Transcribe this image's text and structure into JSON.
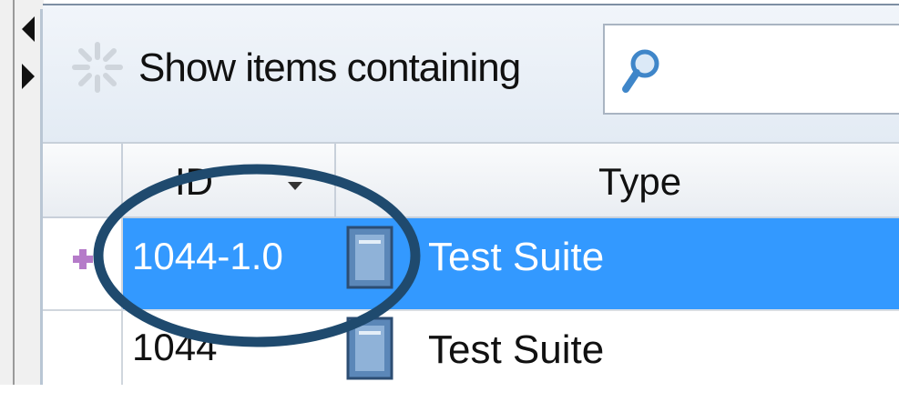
{
  "filter": {
    "label": "Show items containing",
    "search_value": ""
  },
  "grid": {
    "columns": [
      {
        "label": "ID",
        "sort": "descending"
      },
      {
        "label": "Type"
      }
    ],
    "rows": [
      {
        "id": "1044-1.0",
        "type": "Test Suite",
        "selected": true
      },
      {
        "id": "1044",
        "type": "Test Suite",
        "selected": false
      }
    ]
  },
  "colors": {
    "selection": "#3399ff",
    "annotation_ellipse": "#1f4a6e"
  },
  "icons": {
    "toolbar": "spinner-icon",
    "search": "search-icon",
    "row": "test-suite-icon",
    "collapse": "arrow-left-icon",
    "expand": "arrow-right-icon"
  }
}
